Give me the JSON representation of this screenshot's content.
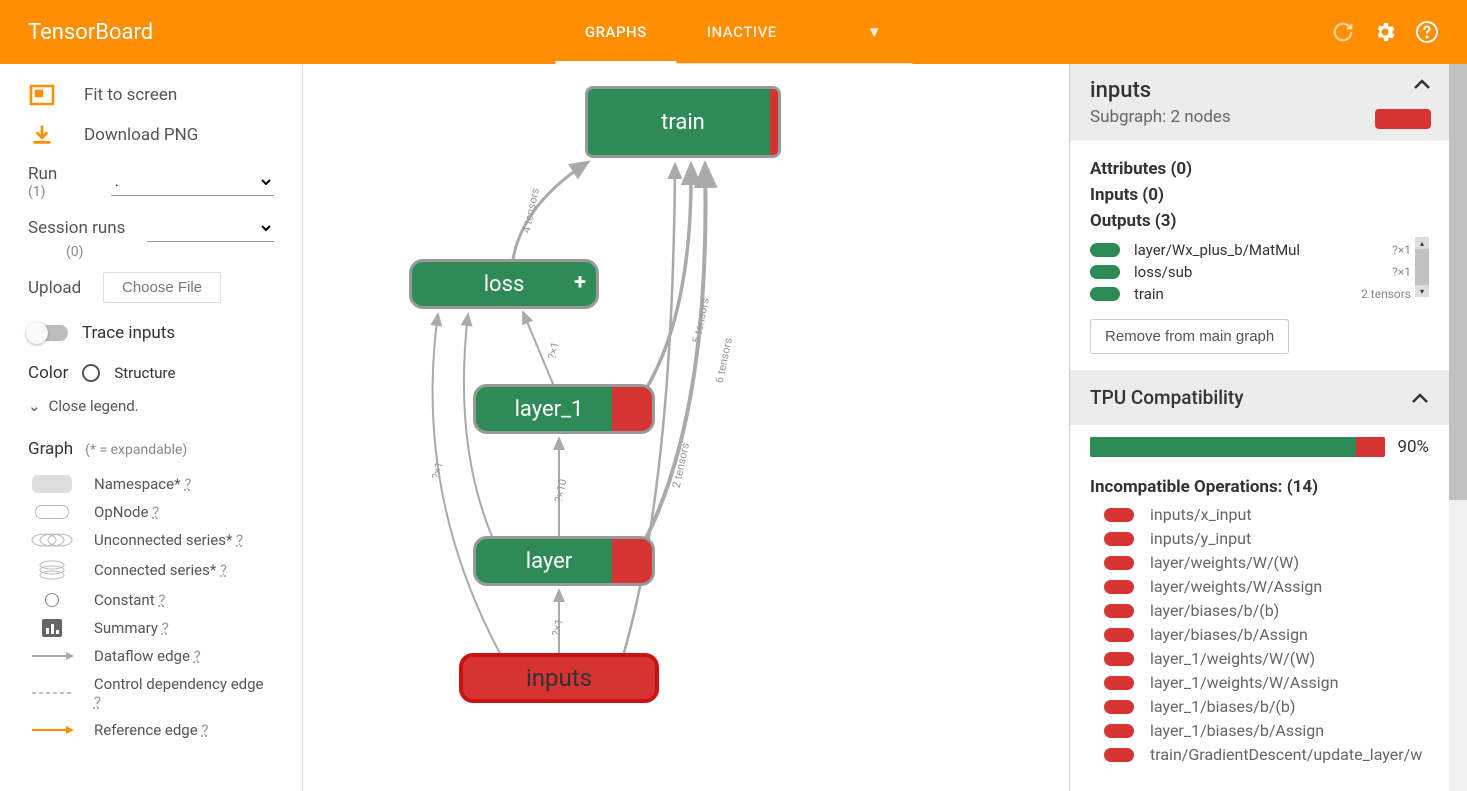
{
  "header": {
    "title": "TensorBoard",
    "tabs": {
      "active": "GRAPHS",
      "inactive": "INACTIVE"
    }
  },
  "sidebar": {
    "fit": "Fit to screen",
    "download": "Download PNG",
    "run_label": "Run",
    "run_count": "(1)",
    "run_value": ".",
    "session_label": "Session runs",
    "session_count": "(0)",
    "upload_label": "Upload",
    "upload_btn": "Choose File",
    "trace_label": "Trace inputs",
    "color_label": "Color",
    "color_value": "Structure",
    "close_legend": "Close legend.",
    "graph_label": "Graph",
    "graph_hint": "(* = expandable)",
    "legend": {
      "namespace": "Namespace* ",
      "opnode": "OpNode ",
      "unconnected": "Unconnected series* ",
      "connected": "Connected series* ",
      "constant": "Constant ",
      "summary": "Summary ",
      "dataflow": "Dataflow edge ",
      "control": "Control dependency edge ",
      "reference": "Reference edge "
    }
  },
  "graph": {
    "train": "train",
    "loss": "loss",
    "layer_1": "layer_1",
    "layer": "layer",
    "inputs": "inputs",
    "edge_4tensors": "4 tensors",
    "edge_5tensors": "5 tensors",
    "edge_6tensors": "6 tensors",
    "edge_2tensors": "2 tensors",
    "edge_q1": "?×1",
    "edge_q10": "?×10"
  },
  "info": {
    "title": "inputs",
    "subtitle": "Subgraph: 2 nodes",
    "attributes": "Attributes (0)",
    "inputs": "Inputs (0)",
    "outputs": "Outputs (3)",
    "output_items": [
      {
        "label": "layer/Wx_plus_b/MatMul",
        "dim": "?×1"
      },
      {
        "label": "loss/sub",
        "dim": "?×1"
      },
      {
        "label": "train",
        "dim": "2 tensors"
      }
    ],
    "remove_btn": "Remove from main graph"
  },
  "tpu": {
    "title": "TPU Compatibility",
    "pct": "90%",
    "pct_value": 90,
    "incompat_title": "Incompatible Operations: (14)",
    "ops": [
      "inputs/x_input",
      "inputs/y_input",
      "layer/weights/W/(W)",
      "layer/weights/W/Assign",
      "layer/biases/b/(b)",
      "layer/biases/b/Assign",
      "layer_1/weights/W/(W)",
      "layer_1/weights/W/Assign",
      "layer_1/biases/b/(b)",
      "layer_1/biases/b/Assign",
      "train/GradientDescent/update_layer/w"
    ]
  },
  "q": "?"
}
